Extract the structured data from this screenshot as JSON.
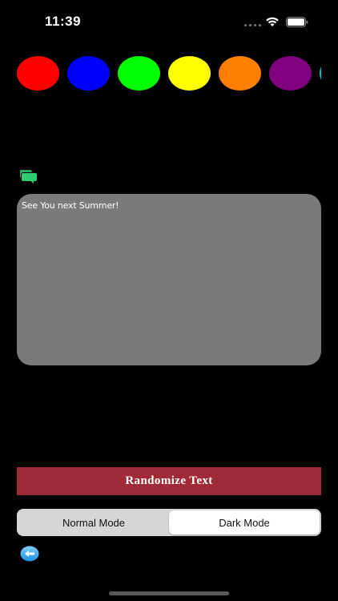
{
  "status_bar": {
    "time": "11:39"
  },
  "color_palette": {
    "colors": [
      "#ff0000",
      "#0000ff",
      "#00ff00",
      "#ffff00",
      "#ff8000",
      "#800080",
      "#00c8c8"
    ]
  },
  "message": {
    "text": "See You next Summer!"
  },
  "randomize_button": {
    "label": "Randomize Text",
    "color": "#a02a38"
  },
  "mode_control": {
    "options": [
      "Normal Mode",
      "Dark Mode"
    ],
    "selected": "Dark Mode"
  },
  "icons": {
    "chat": "chat-bubbles-icon",
    "back": "back-arrow-icon"
  }
}
